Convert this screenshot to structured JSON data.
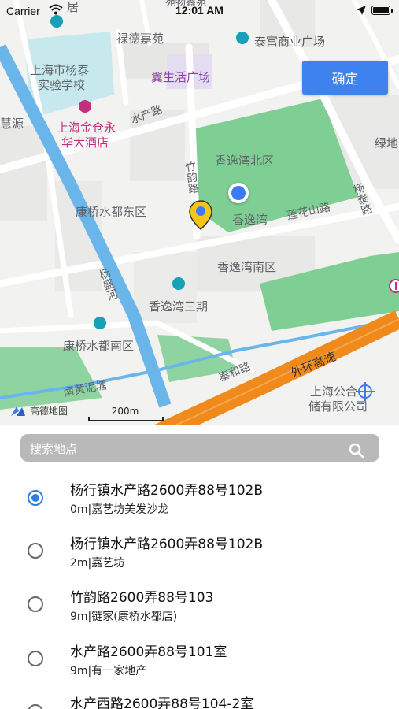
{
  "status_bar": {
    "carrier": "Carrier",
    "time": "12:01 AM"
  },
  "map": {
    "labels": {
      "lude_jiayuan": "禄德嘉苑",
      "taifu_plaza": "泰富商业广场",
      "yangtai_school_1": "上海市杨泰",
      "yangtai_school_2": "实验学校",
      "yisheng_plaza": "翼生活广场",
      "jincangyong_1": "上海金仓永",
      "jincangyong_2": "华大酒店",
      "shuichan_road": "水产路",
      "huiyuan": "慧源",
      "luxi": "绿地",
      "xiangyiwan_north": "香逸湾北区",
      "zhuyun_road": "竹韵路",
      "kangqiao_east": "康桥水都东区",
      "xiangyiwan": "香逸湾",
      "lianhua_road": "莲花山路",
      "yangtai_road": "杨泰路",
      "xiangyiwan_south": "香逸湾南区",
      "yangsheng_river": "杨盛河",
      "xiangyiwan_phase3": "香逸湾三期",
      "kangqiao_south": "康桥水都南区",
      "waihuan_expressway": "外环高速",
      "taihe_road": "泰和路",
      "nanhuangni": "南黄泥塘",
      "gongyi_1": "上海公合",
      "gongyi_2": "储有限公司",
      "top_cut_1": "居",
      "top_cut_2": "苑物鑫苑"
    },
    "confirm_label": "确定",
    "logo_text": "高德地图",
    "scale_text": "200m"
  },
  "search": {
    "placeholder": "搜索地点"
  },
  "results": [
    {
      "title": "杨行镇水产路2600弄88号102B",
      "subtitle": "0m|嘉艺坊美发沙龙",
      "selected": true
    },
    {
      "title": "杨行镇水产路2600弄88号102B",
      "subtitle": "2m|嘉艺坊",
      "selected": false
    },
    {
      "title": "竹韵路2600弄88号103",
      "subtitle": "9m|链家(康桥水都店)",
      "selected": false
    },
    {
      "title": "水产路2600弄88号101室",
      "subtitle": "9m|有一家地产",
      "selected": false
    },
    {
      "title": "水产西路2600弄88号104-2室",
      "subtitle": "",
      "selected": false
    }
  ],
  "colors": {
    "accent": "#3e82f0",
    "park": "#8fd4a0",
    "river": "#6ab5ea",
    "expressway": "#f08a1c"
  }
}
